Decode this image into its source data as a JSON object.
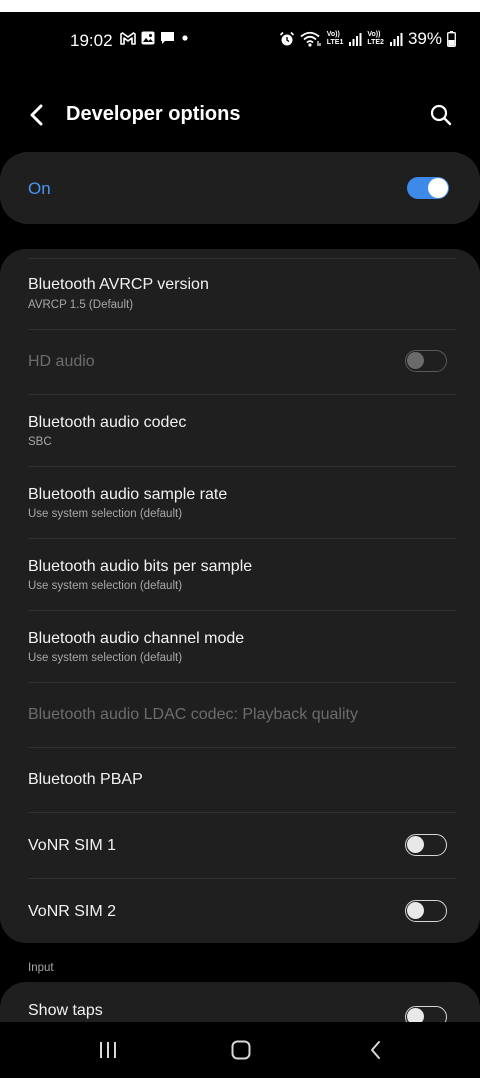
{
  "status_bar": {
    "time": "19:02",
    "notification_icons": [
      "gmail-icon",
      "photo-icon",
      "message-icon",
      "dot-icon"
    ],
    "right_icons": [
      "alarm-icon",
      "wifi-icon",
      "volte-sim1-icon",
      "signal-sim1-icon",
      "volte-sim2-icon",
      "signal-sim2-icon"
    ],
    "sim1_tag_top": "Vo))",
    "sim1_tag_bottom": "LTE1",
    "sim2_tag_top": "Vo))",
    "sim2_tag_bottom": "LTE2",
    "battery": "39%"
  },
  "header": {
    "title": "Developer options"
  },
  "master": {
    "label": "On",
    "enabled": true,
    "accent": "#3e8ae8"
  },
  "settings": [
    {
      "title": "Bluetooth AVRCP version",
      "subtitle": "AVRCP 1.5 (Default)",
      "disabled": false
    },
    {
      "title": "HD audio",
      "disabled": true,
      "toggle": "off"
    },
    {
      "title": "Bluetooth audio codec",
      "subtitle": "SBC",
      "disabled": false
    },
    {
      "title": "Bluetooth audio sample rate",
      "subtitle": "Use system selection (default)",
      "disabled": false
    },
    {
      "title": "Bluetooth audio bits per sample",
      "subtitle": "Use system selection (default)",
      "disabled": false
    },
    {
      "title": "Bluetooth audio channel mode",
      "subtitle": "Use system selection (default)",
      "disabled": false
    },
    {
      "title": "Bluetooth audio LDAC codec: Playback quality",
      "disabled": true
    },
    {
      "title": "Bluetooth PBAP",
      "disabled": false
    },
    {
      "title": "VoNR SIM 1",
      "disabled": false,
      "toggle": "off"
    },
    {
      "title": "VoNR SIM 2",
      "disabled": false,
      "toggle": "off"
    }
  ],
  "input_section": {
    "label": "Input",
    "items": [
      {
        "title": "Show taps",
        "toggle": "off"
      }
    ]
  },
  "nav_bar": {
    "buttons": [
      "recents-icon",
      "home-icon",
      "back-icon"
    ]
  }
}
